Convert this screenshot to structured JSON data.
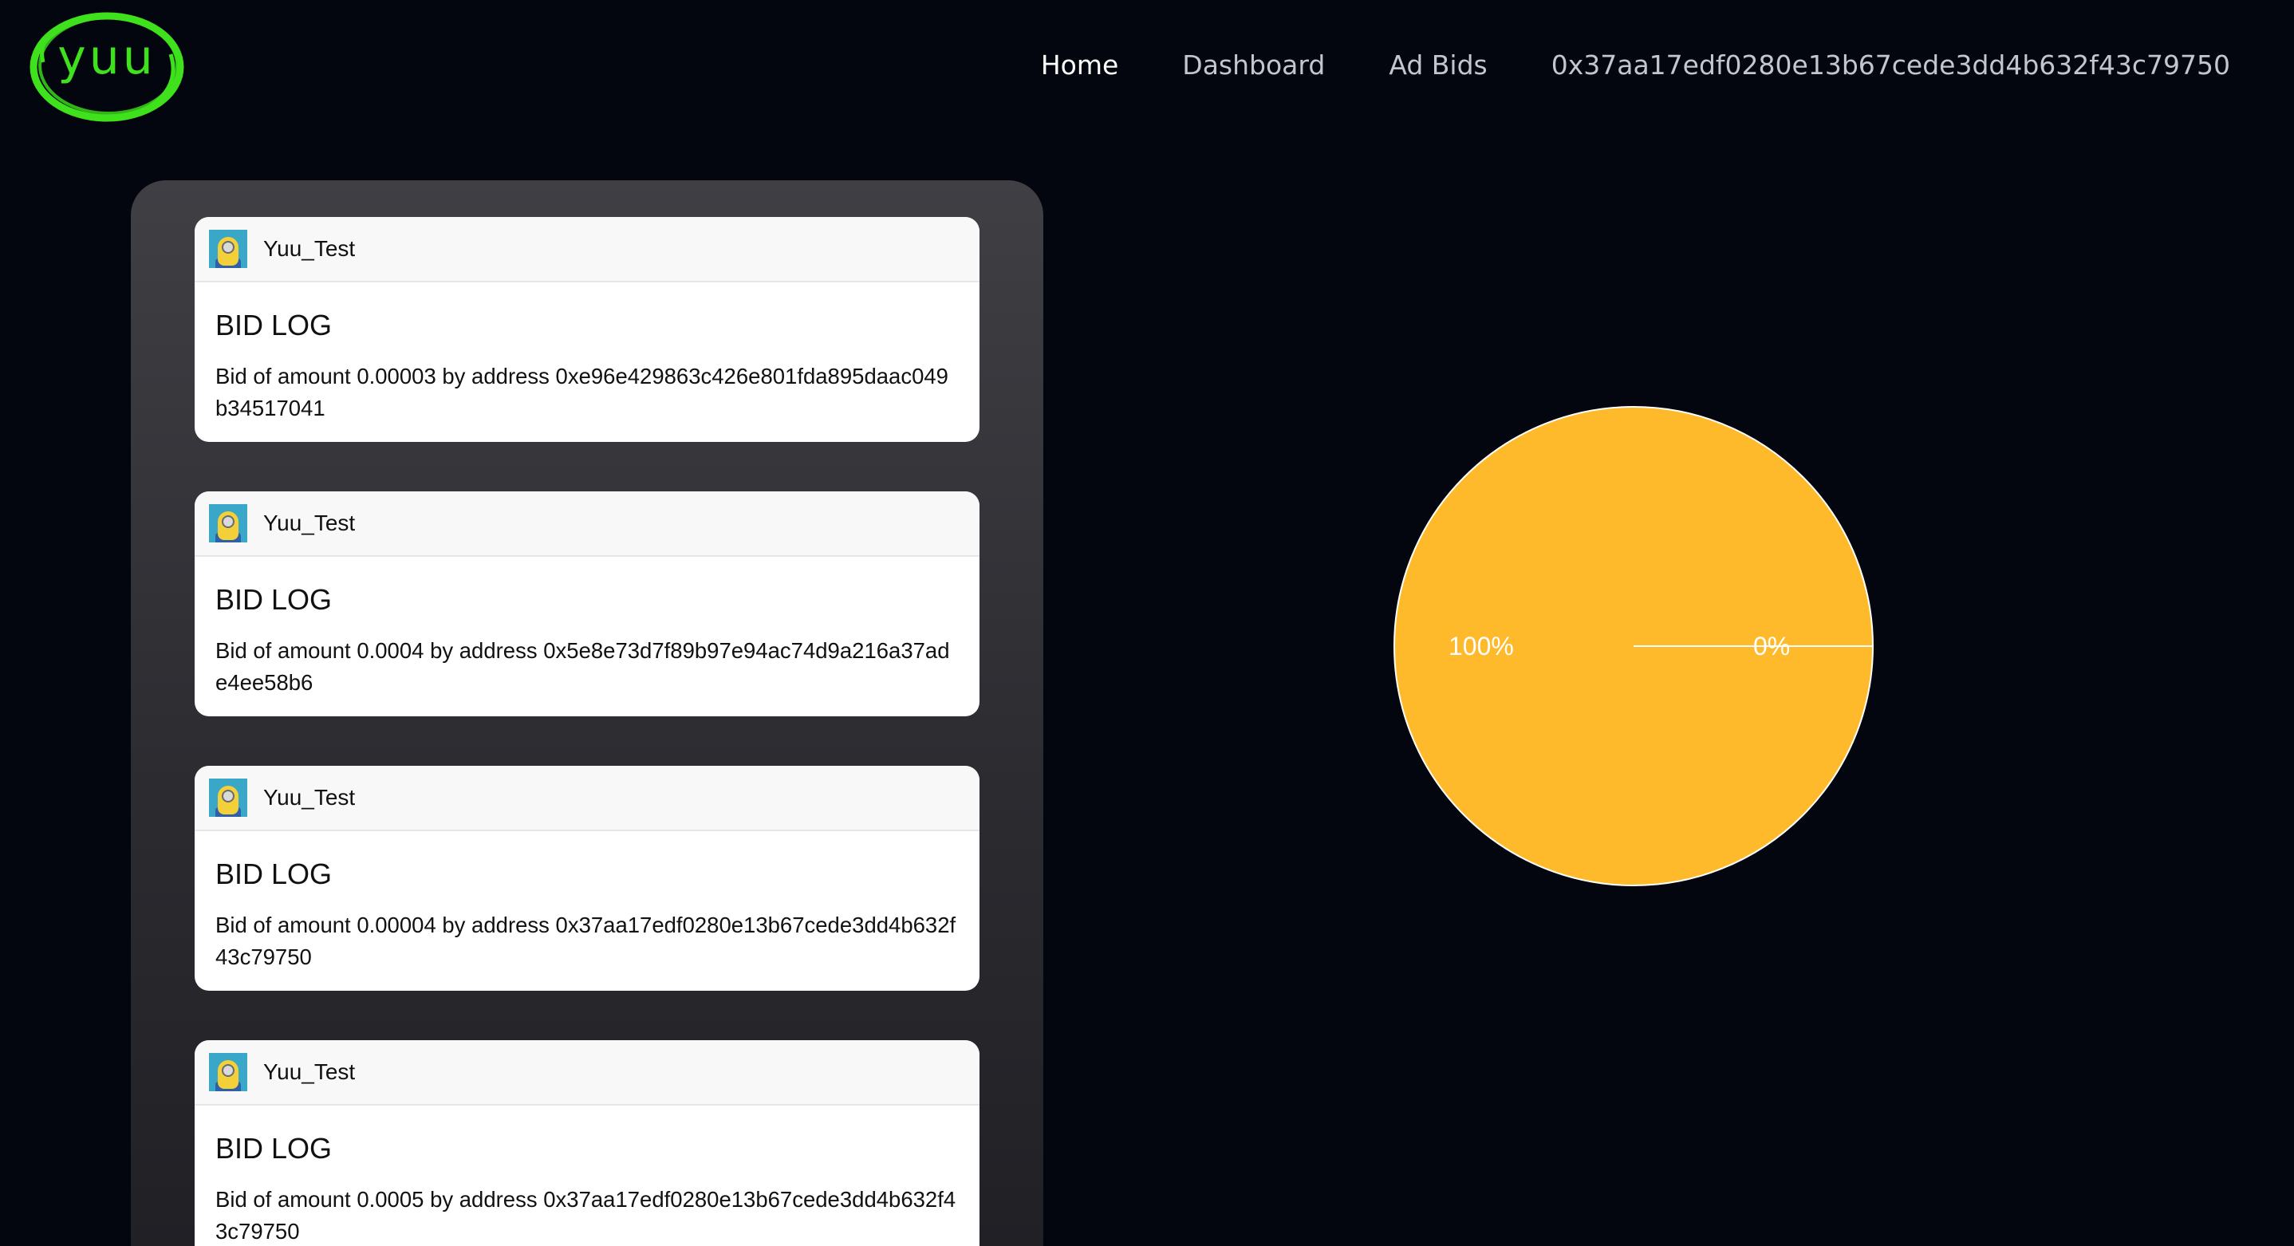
{
  "brand": {
    "logo_text": "yuu",
    "logo_color": "#3ee11c"
  },
  "nav": {
    "items": [
      {
        "label": "Home",
        "active": true
      },
      {
        "label": "Dashboard",
        "active": false
      },
      {
        "label": "Ad Bids",
        "active": false
      },
      {
        "label": "0x37aa17edf0280e13b67cede3dd4b632f43c79750",
        "active": false
      }
    ]
  },
  "bid_logs": [
    {
      "user": "Yuu_Test",
      "avatar_icon": "minion-avatar-icon",
      "title": "BID LOG",
      "text": "Bid of amount 0.00003 by address 0xe96e429863c426e801fda895daac049b34517041"
    },
    {
      "user": "Yuu_Test",
      "avatar_icon": "minion-avatar-icon",
      "title": "BID LOG",
      "text": "Bid of amount 0.0004 by address 0x5e8e73d7f89b97e94ac74d9a216a37ade4ee58b6"
    },
    {
      "user": "Yuu_Test",
      "avatar_icon": "minion-avatar-icon",
      "title": "BID LOG",
      "text": "Bid of amount 0.00004 by address 0x37aa17edf0280e13b67cede3dd4b632f43c79750"
    },
    {
      "user": "Yuu_Test",
      "avatar_icon": "minion-avatar-icon",
      "title": "BID LOG",
      "text": "Bid of amount 0.0005 by address 0x37aa17edf0280e13b67cede3dd4b632f43c79750"
    }
  ],
  "chart_data": {
    "type": "pie",
    "slices": [
      {
        "label": "100%",
        "value": 100,
        "color": "#ffba2b"
      },
      {
        "label": "0%",
        "value": 0,
        "color": "#ffba2b"
      }
    ],
    "border_color": "#ffffff"
  },
  "colors": {
    "background": "#03060f",
    "nav_active": "#ffffff",
    "nav_inactive": "#c4c6cd",
    "pie_fill": "#ffba2b"
  }
}
